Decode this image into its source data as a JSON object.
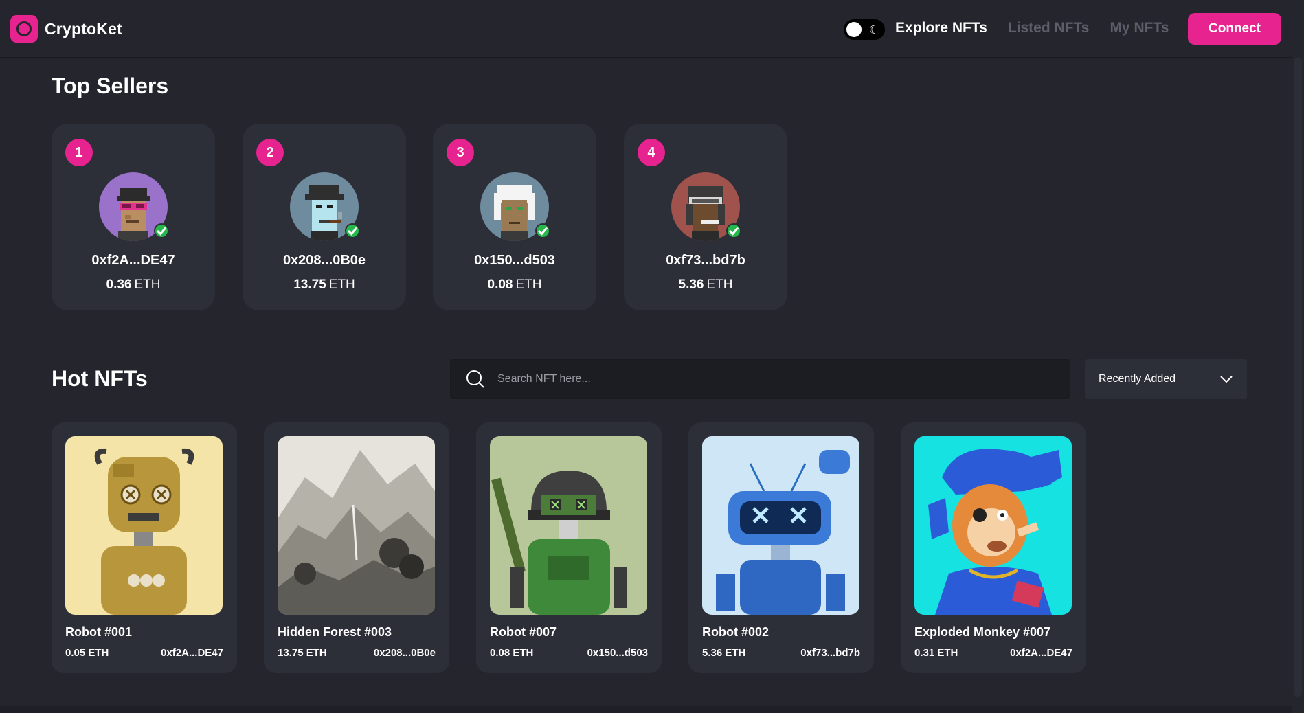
{
  "brand": {
    "name": "CryptoKet",
    "accent": "#e7238f"
  },
  "nav": {
    "links": [
      {
        "label": "Explore NFTs",
        "active": true
      },
      {
        "label": "Listed NFTs",
        "active": false
      },
      {
        "label": "My NFTs",
        "active": false
      }
    ],
    "connect_label": "Connect",
    "theme": "dark"
  },
  "top_sellers": {
    "title": "Top Sellers",
    "items": [
      {
        "rank": "1",
        "address": "0xf2A...DE47",
        "amount": "0.36",
        "unit": "ETH",
        "avatar_bg": "#9b72c9"
      },
      {
        "rank": "2",
        "address": "0x208...0B0e",
        "amount": "13.75",
        "unit": "ETH",
        "avatar_bg": "#6f8c9e"
      },
      {
        "rank": "3",
        "address": "0x150...d503",
        "amount": "0.08",
        "unit": "ETH",
        "avatar_bg": "#6f8c9e"
      },
      {
        "rank": "4",
        "address": "0xf73...bd7b",
        "amount": "5.36",
        "unit": "ETH",
        "avatar_bg": "#a0524c"
      }
    ]
  },
  "hot_nfts": {
    "title": "Hot NFTs",
    "search": {
      "placeholder": "Search NFT here...",
      "value": ""
    },
    "sort": {
      "selected": "Recently Added"
    },
    "items": [
      {
        "name": "Robot #001",
        "price": "0.05 ETH",
        "owner": "0xf2A...DE47",
        "image": "gold-robot"
      },
      {
        "name": "Hidden Forest #003",
        "price": "13.75 ETH",
        "owner": "0x208...0B0e",
        "image": "ink-landscape"
      },
      {
        "name": "Robot #007",
        "price": "0.08 ETH",
        "owner": "0x150...d503",
        "image": "green-robot"
      },
      {
        "name": "Robot #002",
        "price": "5.36 ETH",
        "owner": "0xf73...bd7b",
        "image": "blue-robot"
      },
      {
        "name": "Exploded Monkey #007",
        "price": "0.31 ETH",
        "owner": "0xf2A...DE47",
        "image": "monkey"
      }
    ]
  }
}
